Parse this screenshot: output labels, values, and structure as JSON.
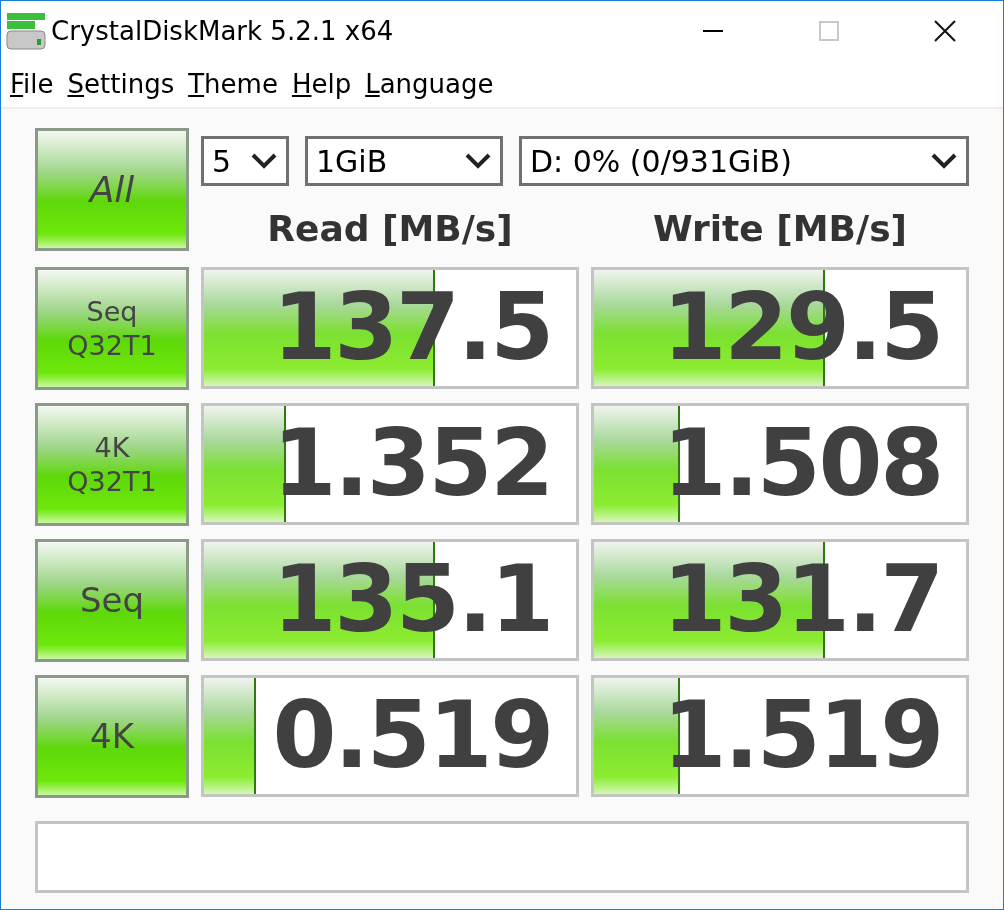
{
  "window": {
    "title": "CrystalDiskMark 5.2.1 x64"
  },
  "menu": [
    "File",
    "Settings",
    "Theme",
    "Help",
    "Language"
  ],
  "all_button": "All",
  "selects": [
    {
      "value": "5"
    },
    {
      "value": "1GiB"
    },
    {
      "value": "D: 0% (0/931GiB)"
    }
  ],
  "columns": [
    "Read [MB/s]",
    "Write [MB/s]"
  ],
  "tests": [
    {
      "label": [
        "Seq",
        "Q32T1"
      ],
      "read": {
        "value": "137.5",
        "level": 0.62
      },
      "write": {
        "value": "129.5",
        "level": 0.62
      }
    },
    {
      "label": [
        "4K",
        "Q32T1"
      ],
      "read": {
        "value": "1.352",
        "level": 0.22
      },
      "write": {
        "value": "1.508",
        "level": 0.23
      }
    },
    {
      "label": [
        "Seq"
      ],
      "read": {
        "value": "135.1",
        "level": 0.62
      },
      "write": {
        "value": "131.7",
        "level": 0.62
      }
    },
    {
      "label": [
        "4K"
      ],
      "read": {
        "value": "0.519",
        "level": 0.14
      },
      "write": {
        "value": "1.519",
        "level": 0.23
      }
    }
  ]
}
